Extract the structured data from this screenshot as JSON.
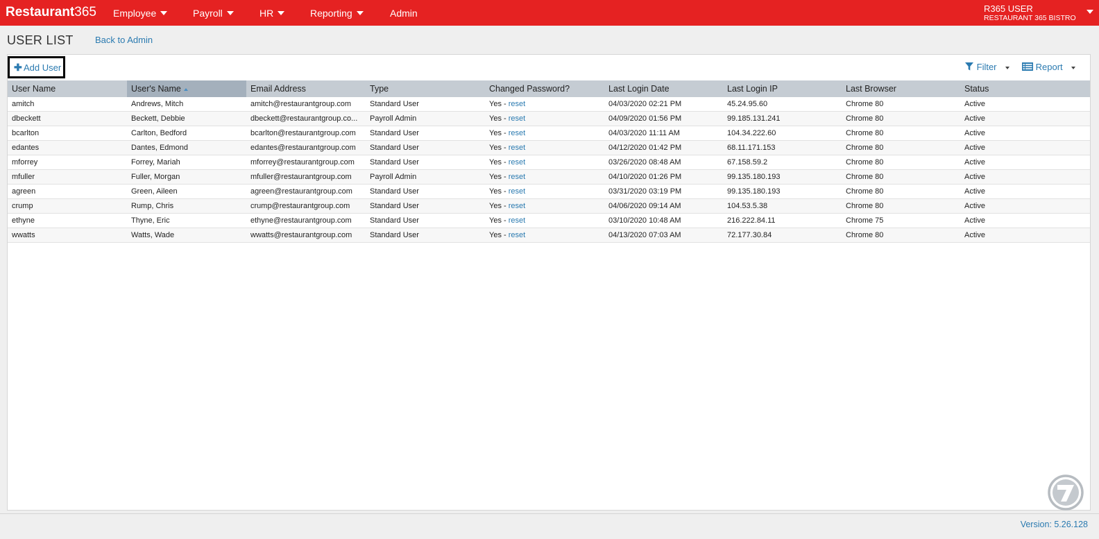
{
  "app": {
    "logo_bold": "Restaurant",
    "logo_thin": "365"
  },
  "nav": {
    "employee": "Employee",
    "payroll": "Payroll",
    "hr": "HR",
    "reporting": "Reporting",
    "admin": "Admin"
  },
  "user": {
    "name": "R365 USER",
    "org": "RESTAURANT 365 BISTRO"
  },
  "page": {
    "title": "USER LIST",
    "back_link": "Back to Admin"
  },
  "toolbar": {
    "add_user": "Add User",
    "filter": "Filter",
    "report": "Report"
  },
  "table": {
    "columns": [
      "User Name",
      "User's Name",
      "Email Address",
      "Type",
      "Changed Password?",
      "Last Login Date",
      "Last Login IP",
      "Last Browser",
      "Status"
    ],
    "sorted_column": "User's Name",
    "rows": [
      {
        "user_name": "amitch",
        "name": "Andrews, Mitch",
        "email": "amitch@restaurantgroup.com",
        "type": "Standard User",
        "changed": "Yes - ",
        "reset": "reset",
        "last_login": "04/03/2020 02:21 PM",
        "ip": "45.24.95.60",
        "browser": "Chrome 80",
        "status": "Active"
      },
      {
        "user_name": "dbeckett",
        "name": "Beckett, Debbie",
        "email": "dbeckett@restaurantgroup.co...",
        "type": "Payroll Admin",
        "changed": "Yes - ",
        "reset": "reset",
        "last_login": "04/09/2020 01:56 PM",
        "ip": "99.185.131.241",
        "browser": "Chrome 80",
        "status": "Active"
      },
      {
        "user_name": "bcarlton",
        "name": "Carlton, Bedford",
        "email": "bcarlton@restaurantgroup.com",
        "type": "Standard User",
        "changed": "Yes - ",
        "reset": "reset",
        "last_login": "04/03/2020 11:11 AM",
        "ip": "104.34.222.60",
        "browser": "Chrome 80",
        "status": "Active"
      },
      {
        "user_name": "edantes",
        "name": "Dantes, Edmond",
        "email": "edantes@restaurantgroup.com",
        "type": "Standard User",
        "changed": "Yes - ",
        "reset": "reset",
        "last_login": "04/12/2020 01:42 PM",
        "ip": "68.11.171.153",
        "browser": "Chrome 80",
        "status": "Active"
      },
      {
        "user_name": "mforrey",
        "name": "Forrey, Mariah",
        "email": "mforrey@restaurantgroup.com",
        "type": "Standard User",
        "changed": "Yes - ",
        "reset": "reset",
        "last_login": "03/26/2020 08:48 AM",
        "ip": "67.158.59.2",
        "browser": "Chrome 80",
        "status": "Active"
      },
      {
        "user_name": "mfuller",
        "name": "Fuller, Morgan",
        "email": "mfuller@restaurantgroup.com",
        "type": "Payroll Admin",
        "changed": "Yes - ",
        "reset": "reset",
        "last_login": "04/10/2020 01:26 PM",
        "ip": "99.135.180.193",
        "browser": "Chrome 80",
        "status": "Active"
      },
      {
        "user_name": "agreen",
        "name": "Green, Aileen",
        "email": "agreen@restaurantgroup.com",
        "type": "Standard User",
        "changed": "Yes - ",
        "reset": "reset",
        "last_login": "03/31/2020 03:19 PM",
        "ip": "99.135.180.193",
        "browser": "Chrome 80",
        "status": "Active"
      },
      {
        "user_name": "crump",
        "name": "Rump, Chris",
        "email": "crump@restaurantgroup.com",
        "type": "Standard User",
        "changed": "Yes - ",
        "reset": "reset",
        "last_login": "04/06/2020 09:14 AM",
        "ip": "104.53.5.38",
        "browser": "Chrome 80",
        "status": "Active"
      },
      {
        "user_name": "ethyne",
        "name": "Thyne, Eric",
        "email": "ethyne@restaurantgroup.com",
        "type": "Standard User",
        "changed": "Yes - ",
        "reset": "reset",
        "last_login": "03/10/2020 10:48 AM",
        "ip": "216.222.84.11",
        "browser": "Chrome 75",
        "status": "Active"
      },
      {
        "user_name": "wwatts",
        "name": "Watts, Wade",
        "email": "wwatts@restaurantgroup.com",
        "type": "Standard User",
        "changed": "Yes - ",
        "reset": "reset",
        "last_login": "04/13/2020 07:03 AM",
        "ip": "72.177.30.84",
        "browser": "Chrome 80",
        "status": "Active"
      }
    ]
  },
  "footer": {
    "version": "Version: 5.26.128"
  },
  "colors": {
    "brand_red": "#e52222",
    "link_blue": "#2a7ab0",
    "header_gray": "#c5ccd3",
    "sorted_header": "#a4b0bc"
  },
  "icons": {
    "add": "plus-icon",
    "filter": "funnel-icon",
    "report": "list-icon",
    "corner": "app-badge-icon"
  }
}
